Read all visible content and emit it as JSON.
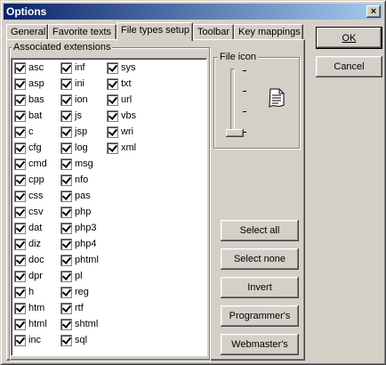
{
  "window": {
    "title": "Options",
    "close_symbol": "×"
  },
  "tabs": [
    {
      "label": "General"
    },
    {
      "label": "Favorite texts"
    },
    {
      "label": "File types setup"
    },
    {
      "label": "Toolbar"
    },
    {
      "label": "Key mappings"
    }
  ],
  "active_tab": "File types setup",
  "extensions_group": {
    "label": "Associated extensions"
  },
  "extensions": [
    [
      "asc",
      "asp",
      "bas",
      "bat",
      "c",
      "cfg",
      "cmd",
      "cpp",
      "css",
      "csv",
      "dat",
      "diz",
      "doc",
      "dpr",
      "h",
      "htm",
      "html",
      "inc"
    ],
    [
      "inf",
      "ini",
      "ion",
      "js",
      "jsp",
      "log",
      "msg",
      "nfo",
      "pas",
      "php",
      "php3",
      "php4",
      "phtml",
      "pl",
      "reg",
      "rtf",
      "shtml",
      "sql"
    ],
    [
      "sys",
      "txt",
      "url",
      "vbs",
      "wri",
      "xml"
    ]
  ],
  "extensions_checked": true,
  "file_icon_group": {
    "label": "File icon"
  },
  "file_icon_slider": {
    "tick_count": 4,
    "selected_index": 3
  },
  "icons": {
    "file": "document-icon",
    "close": "close-icon"
  },
  "buttons": {
    "ok": "OK",
    "cancel": "Cancel",
    "select_all": "Select all",
    "select_none": "Select none",
    "invert": "Invert",
    "programmers": "Programmer's",
    "webmasters": "Webmaster's"
  }
}
